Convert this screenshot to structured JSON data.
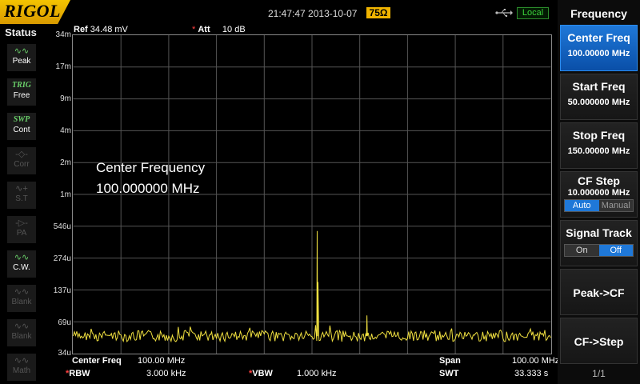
{
  "header": {
    "brand": "RIGOL",
    "datetime": "21:47:47 2013-10-07",
    "impedance": "75Ω",
    "remote_state": "Local"
  },
  "status_panel": {
    "title": "Status",
    "items": [
      {
        "icon": "peak-icon",
        "label": "Peak",
        "enabled": true
      },
      {
        "icon": "TRIG",
        "label": "Free",
        "enabled": true
      },
      {
        "icon": "SWP",
        "label": "Cont",
        "enabled": true
      },
      {
        "icon": "corr-icon",
        "label": "Corr",
        "enabled": false
      },
      {
        "icon": "source-tracking-icon",
        "label": "S.T",
        "enabled": false
      },
      {
        "icon": "preamp-icon",
        "label": "PA",
        "enabled": false
      },
      {
        "icon": "cw-icon",
        "label": "C.W.",
        "enabled": true
      },
      {
        "icon": "trace-icon",
        "label": "Blank",
        "enabled": false
      },
      {
        "icon": "trace-icon",
        "label": "Blank",
        "enabled": false
      },
      {
        "icon": "math-icon",
        "label": "Math",
        "enabled": false
      }
    ]
  },
  "display": {
    "ref_label": "Ref",
    "ref_value": "34.48 mV",
    "att_label": "Att",
    "att_value": "10 dB",
    "y_ticks": [
      "34m",
      "17m",
      "9m",
      "4m",
      "2m",
      "1m",
      "546u",
      "274u",
      "137u",
      "69u",
      "34u"
    ],
    "overlay_title": "Center Frequency",
    "overlay_value": "100.000000 MHz",
    "trace_color": "#f0e040",
    "center_freq_label": "Center Freq",
    "center_freq_value": "100.00 MHz",
    "span_label": "Span",
    "span_value": "100.00 MHz",
    "rbw_label": "RBW",
    "rbw_value": "3.000 kHz",
    "vbw_label": "VBW",
    "vbw_value": "1.000 kHz",
    "swt_label": "SWT",
    "swt_value": "33.333 s"
  },
  "menu": {
    "title": "Frequency",
    "center_freq": {
      "label": "Center Freq",
      "value": "100.00000 MHz"
    },
    "start_freq": {
      "label": "Start Freq",
      "value": "50.000000 MHz"
    },
    "stop_freq": {
      "label": "Stop Freq",
      "value": "150.00000 MHz"
    },
    "cf_step": {
      "label": "CF Step",
      "value": "10.000000 MHz",
      "opt_auto": "Auto",
      "opt_manual": "Manual",
      "selected": "Auto"
    },
    "signal_track": {
      "label": "Signal Track",
      "opt_on": "On",
      "opt_off": "Off",
      "selected": "Off"
    },
    "peak_cf": {
      "label": "Peak->CF"
    },
    "cf_step_set": {
      "label": "CF->Step"
    },
    "page": "1/1"
  },
  "colors": {
    "accent": "#1f78d8",
    "brand": "#f0b400",
    "trace": "#f0e040"
  }
}
